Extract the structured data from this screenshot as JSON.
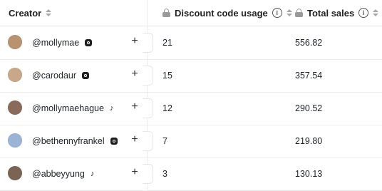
{
  "header": {
    "creator_label": "Creator",
    "discount_label": "Discount code usage",
    "sales_label": "Total sales"
  },
  "rows": [
    {
      "handle": "@mollymae",
      "platform": "instagram-icon",
      "usage": "21",
      "sales": "556.82",
      "avatar_color": "#b9926f"
    },
    {
      "handle": "@carodaur",
      "platform": "instagram-icon",
      "usage": "15",
      "sales": "357.54",
      "avatar_color": "#c8a888"
    },
    {
      "handle": "@mollymaehague",
      "platform": "tiktok-icon",
      "usage": "12",
      "sales": "290.52",
      "avatar_color": "#8a6a5a"
    },
    {
      "handle": "@bethennyfrankel",
      "platform": "instagram-icon",
      "usage": "7",
      "sales": "219.80",
      "avatar_color": "#9bb4d6"
    },
    {
      "handle": "@abbeyyung",
      "platform": "tiktok-icon",
      "usage": "3",
      "sales": "130.13",
      "avatar_color": "#7a6555"
    }
  ],
  "colors": {
    "text": "#1f2328",
    "muted_icon": "#a7a7a7",
    "divider": "#ececec"
  }
}
